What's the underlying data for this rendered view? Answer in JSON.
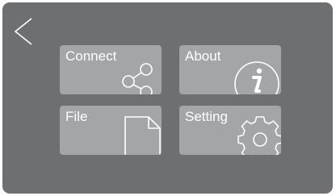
{
  "screen": {
    "background": "#6e6f71",
    "tile_color": "#a4a5a7"
  },
  "icons": {
    "back": "back-arrow-icon",
    "connect": "share-icon",
    "about": "info-icon",
    "file": "file-icon",
    "setting": "gear-icon"
  },
  "tiles": [
    {
      "label": "Connect"
    },
    {
      "label": "About"
    },
    {
      "label": "File"
    },
    {
      "label": "Setting"
    }
  ]
}
